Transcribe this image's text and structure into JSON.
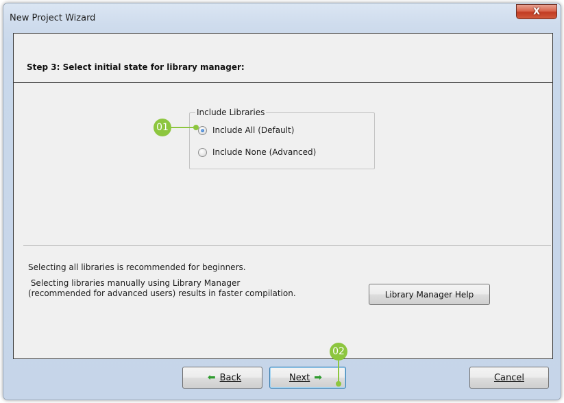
{
  "window": {
    "title": "New Project Wizard",
    "close_label": "X"
  },
  "step": {
    "title": "Step 3: Select initial state for library manager:"
  },
  "include_libraries": {
    "legend": "Include Libraries",
    "options": [
      {
        "label": "Include All (Default)",
        "checked": true
      },
      {
        "label": "Include None (Advanced)",
        "checked": false
      }
    ]
  },
  "info": {
    "line1": "Selecting all libraries is recommended for beginners.",
    "line2": " Selecting libraries manually using Library Manager",
    "line3": "(recommended for advanced users) results in faster compilation.",
    "help_button": "Library Manager Help"
  },
  "footer": {
    "back_label": "Back",
    "next_label": "Next",
    "cancel_label": "Cancel"
  },
  "callouts": {
    "one": "01",
    "two": "02",
    "color": "#8dc63f"
  },
  "icons": {
    "back": "left-arrow-icon",
    "next": "right-arrow-icon"
  }
}
